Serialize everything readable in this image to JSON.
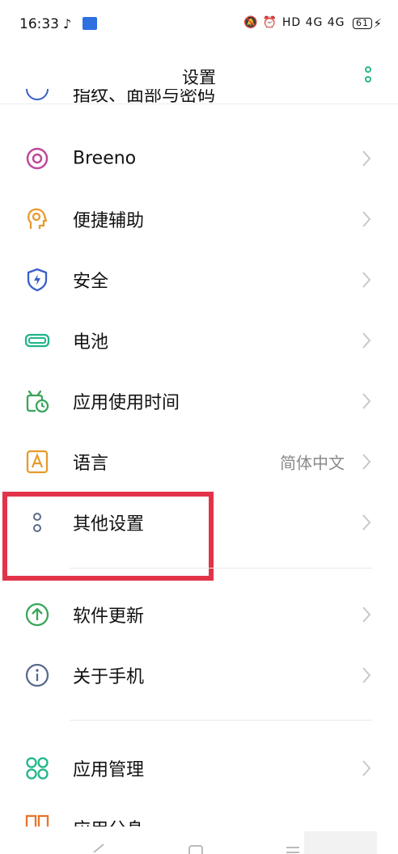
{
  "status_bar": {
    "time": "16:33",
    "right_text": "HD 4G 4G",
    "battery": "61"
  },
  "header": {
    "title": "设置"
  },
  "list": {
    "partial_top_label": "指纹、面部与密码",
    "items": [
      {
        "label": "Breeno",
        "icon": "breeno-icon",
        "color": "#c0489b"
      },
      {
        "label": "便捷辅助",
        "icon": "accessibility-icon",
        "color": "#e89a2a"
      },
      {
        "label": "安全",
        "icon": "shield-icon",
        "color": "#3a5fc8"
      },
      {
        "label": "电池",
        "icon": "battery-icon",
        "color": "#1fb58a"
      },
      {
        "label": "应用使用时间",
        "icon": "clock-icon",
        "color": "#3aa55a"
      },
      {
        "label": "语言",
        "value": "简体中文",
        "icon": "language-icon",
        "color": "#e89a2a"
      },
      {
        "label": "其他设置",
        "icon": "more-settings-icon",
        "color": "#5a6b8c"
      },
      {
        "label": "软件更新",
        "icon": "update-icon",
        "color": "#3aa55a"
      },
      {
        "label": "关于手机",
        "icon": "info-icon",
        "color": "#5a6b8c"
      },
      {
        "label": "应用管理",
        "icon": "apps-icon",
        "color": "#1fb58a"
      },
      {
        "label": "应用分身",
        "icon": "clone-icon",
        "color": "#e8742a"
      }
    ]
  }
}
